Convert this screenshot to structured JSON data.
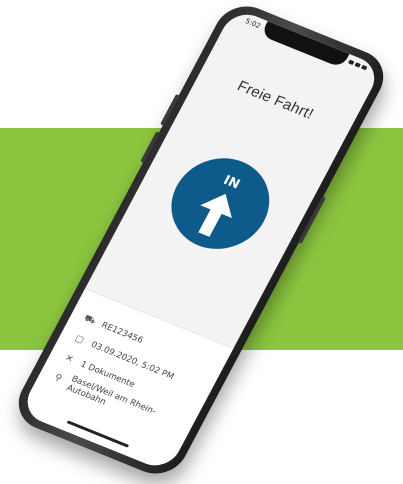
{
  "status": {
    "time": "5:02"
  },
  "screen": {
    "title": "Freie Fahrt!"
  },
  "direction": {
    "label": "IN",
    "color": "#0e5a8a",
    "icon": "arrow-up-icon"
  },
  "info": [
    {
      "icon": "car-icon",
      "text": "RE123456"
    },
    {
      "icon": "calendar-icon",
      "text": "03.09.2020, 5:02 PM"
    },
    {
      "icon": "document-icon",
      "text": "1 Dokumente"
    },
    {
      "icon": "location-pin-icon",
      "text": "Basel/Weil am Rhein-Autobahn"
    }
  ],
  "colors": {
    "band": "#8cc63f",
    "screen": "#f3f3f3",
    "phone": "#2b2b2b"
  }
}
